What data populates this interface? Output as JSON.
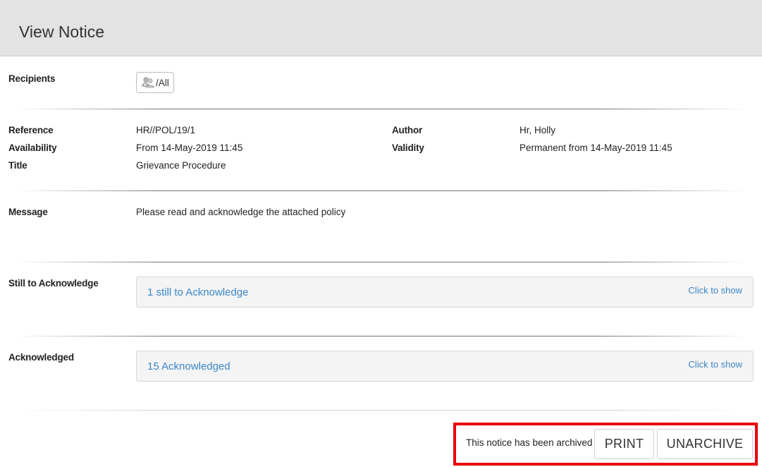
{
  "header": {
    "title": "View Notice"
  },
  "recipients": {
    "label": "Recipients",
    "chip_text": "/All",
    "chip_icon": "group-icon"
  },
  "details": {
    "reference_label": "Reference",
    "reference_value": "HR//POL/19/1",
    "availability_label": "Availability",
    "availability_value": "From 14-May-2019 11:45",
    "title_label": "Title",
    "title_value": "Grievance Procedure",
    "author_label": "Author",
    "author_value": "Hr, Holly",
    "validity_label": "Validity",
    "validity_value": "Permanent from 14-May-2019 11:45"
  },
  "message": {
    "label": "Message",
    "text": "Please read and acknowledge the attached policy"
  },
  "still_to_acknowledge": {
    "label": "Still to Acknowledge",
    "summary": "1 still to Acknowledge",
    "toggle": "Click to show"
  },
  "acknowledged": {
    "label": "Acknowledged",
    "summary": "15 Acknowledged",
    "toggle": "Click to show"
  },
  "footer": {
    "status_text": "This notice has been archived",
    "print_label": "PRINT",
    "unarchive_label": "UNARCHIVE"
  },
  "colors": {
    "link": "#3a87c7",
    "highlight_border": "#e8000e",
    "header_bg": "#e3e3e3",
    "panel_bg": "#f4f4f4"
  }
}
